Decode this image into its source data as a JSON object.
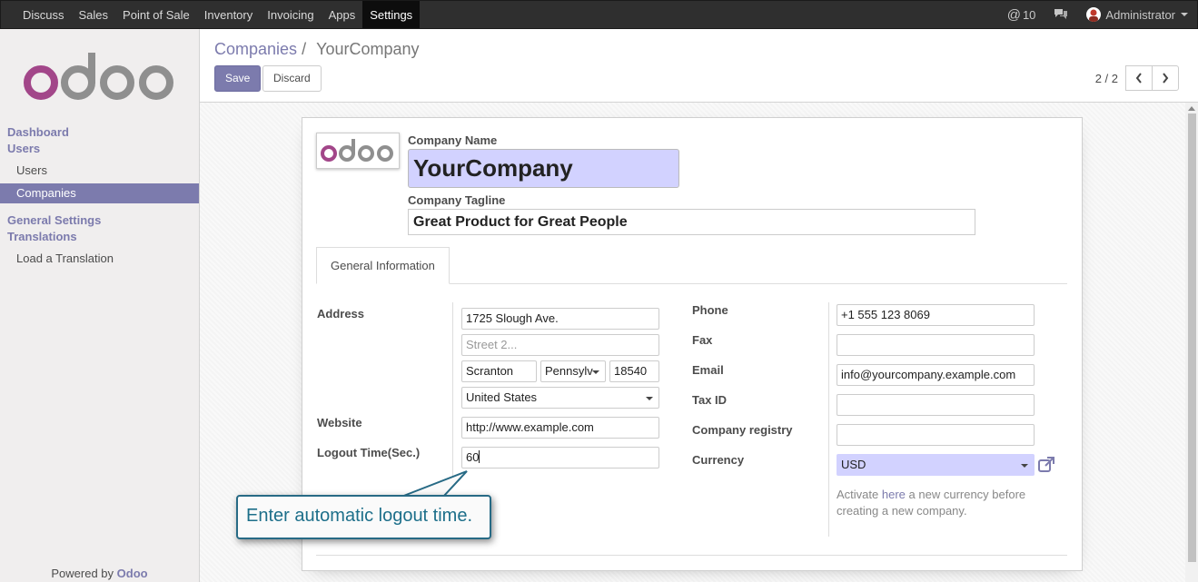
{
  "topbar": {
    "menu": [
      "Discuss",
      "Sales",
      "Point of Sale",
      "Inventory",
      "Invoicing",
      "Apps",
      "Settings"
    ],
    "active": "Settings",
    "notification_count": "10",
    "user_name": "Administrator"
  },
  "sidebar": {
    "logo_text": "odoo",
    "section_dashboard": "Dashboard",
    "section_users": "Users",
    "item_users": "Users",
    "item_companies": "Companies",
    "section_general_settings": "General Settings",
    "section_translations": "Translations",
    "item_load_translation": "Load a Translation",
    "powered_by": "Powered by",
    "powered_brand": "Odoo"
  },
  "control": {
    "breadcrumb_parent": "Companies",
    "breadcrumb_sep": "/",
    "breadcrumb_current": "YourCompany",
    "save_label": "Save",
    "discard_label": "Discard",
    "pager_value": "2 / 2"
  },
  "form": {
    "company_name_label": "Company Name",
    "company_name": "YourCompany",
    "tagline_label": "Company Tagline",
    "tagline": "Great Product for Great People",
    "tab_general": "General Information",
    "address_label": "Address",
    "street": "1725 Slough Ave.",
    "street2_placeholder": "Street 2...",
    "city": "Scranton",
    "state": "Pennsylv",
    "zip": "18540",
    "country": "United States",
    "website_label": "Website",
    "website": "http://www.example.com",
    "logout_label": "Logout Time(Sec.)",
    "logout_value": "60",
    "phone_label": "Phone",
    "phone": "+1 555 123 8069",
    "fax_label": "Fax",
    "fax": "",
    "email_label": "Email",
    "email": "info@yourcompany.example.com",
    "taxid_label": "Tax ID",
    "taxid": "",
    "registry_label": "Company registry",
    "registry": "",
    "currency_label": "Currency",
    "currency": "USD",
    "note_activate": "Activate",
    "note_here": "here",
    "note_rest": "a new currency before",
    "note_line2": "creating a new company."
  },
  "callout": {
    "text": "Enter automatic logout time."
  },
  "colors": {
    "brand": "#7c7bad",
    "topbar": "#2f2f2f",
    "highlight_field": "#d2d2ff",
    "callout_border": "#276a85"
  }
}
